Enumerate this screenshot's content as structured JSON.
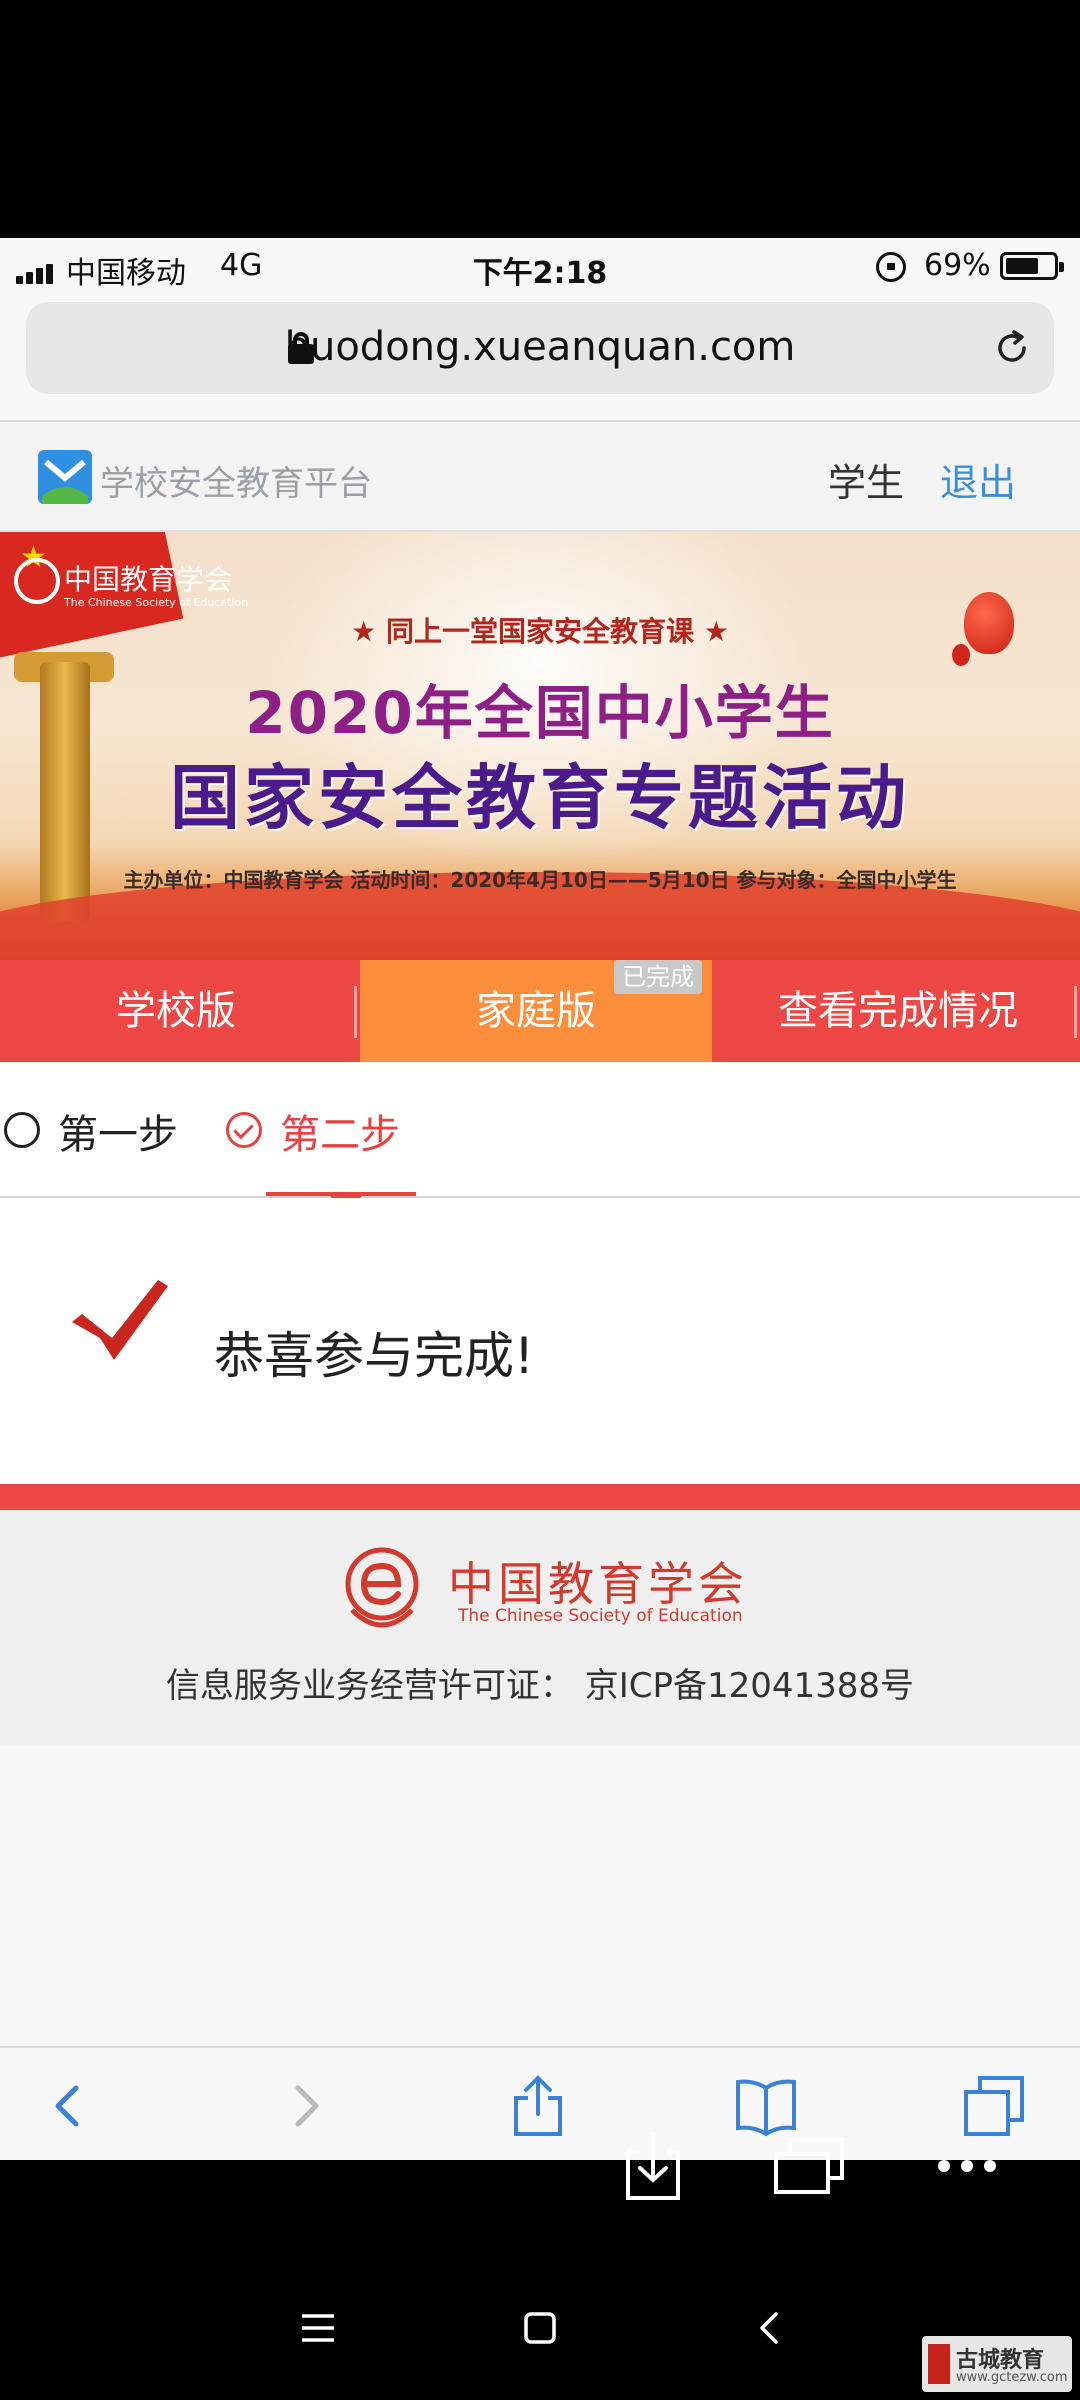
{
  "status_bar": {
    "carrier": "中国移动",
    "network": "4G",
    "time": "下午2:18",
    "battery_percent": "69%",
    "battery_level": 0.69
  },
  "browser": {
    "url": "huodong.xueanquan.com"
  },
  "site_header": {
    "site_name": "学校安全教育平台",
    "user_role": "学生",
    "logout_label": "退出"
  },
  "banner": {
    "org_name": "中国教育学会",
    "org_name_en": "The Chinese Society of Education",
    "tagline": "★ 同上一堂国家安全教育课 ★",
    "title_line1": "2020年全国中小学生",
    "title_line2": "国家安全教育专题活动",
    "meta": "主办单位：中国教育学会   活动时间：2020年4月10日——5月10日   参与对象：全国中小学生"
  },
  "version_tabs": {
    "school": "学校版",
    "family": "家庭版",
    "family_badge": "已完成",
    "progress": "查看完成情况",
    "active": "family"
  },
  "steps": {
    "step1": "第一步",
    "step2": "第二步",
    "active": "step2"
  },
  "result": {
    "message": "恭喜参与完成!"
  },
  "footer": {
    "org_name": "中国教育学会",
    "org_name_en": "The Chinese Society of Education",
    "license": "信息服务业务经营许可证：   京ICP备12041388号"
  },
  "watermark": {
    "text": "古城教育",
    "url": "www.gctezw.com"
  },
  "colors": {
    "primary_red": "#ec4745",
    "active_orange": "#fb8d3b",
    "link_blue": "#3a8fdc",
    "ios_blue": "#3b82d6"
  },
  "icons": {
    "toolbar": [
      "back-icon",
      "forward-icon",
      "share-icon",
      "bookmarks-icon",
      "tabs-icon"
    ],
    "overlay": [
      "download-icon",
      "windows-icon",
      "more-icon"
    ],
    "system_nav": [
      "menu-icon",
      "home-icon",
      "nav-back-icon"
    ]
  }
}
